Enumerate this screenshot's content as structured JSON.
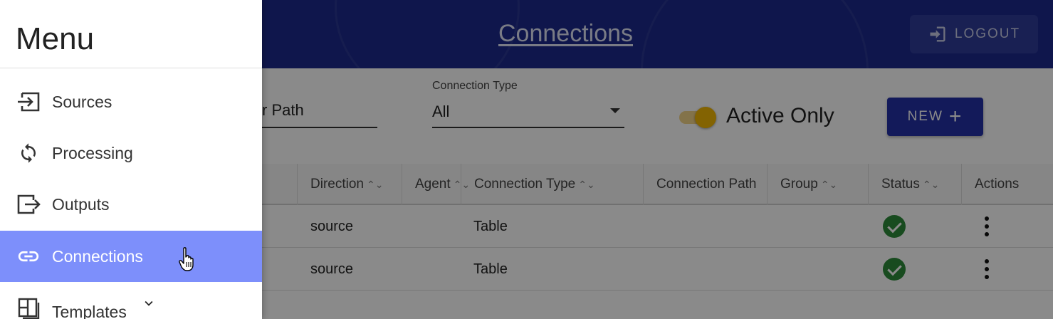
{
  "header": {
    "title": "Connections",
    "logout_label": "LOGOUT",
    "background_color": "#1d2a8c"
  },
  "filters": {
    "path_value_fragment": "r Path",
    "connection_type_label": "Connection Type",
    "connection_type_value": "All",
    "active_only_label": "Active Only",
    "active_only_on": true,
    "new_label": "NEW"
  },
  "table": {
    "columns": [
      {
        "label": "Direction",
        "sortable": true
      },
      {
        "label": "Agent",
        "sortable": true
      },
      {
        "label": "Connection Type",
        "sortable": true
      },
      {
        "label": "Connection Path",
        "sortable": false
      },
      {
        "label": "Group",
        "sortable": true
      },
      {
        "label": "Status",
        "sortable": true
      },
      {
        "label": "Actions",
        "sortable": false
      }
    ],
    "rows": [
      {
        "direction": "source",
        "agent": "",
        "connection_type": "Table",
        "connection_path": "",
        "group": "",
        "status": "active"
      },
      {
        "direction": "source",
        "agent": "",
        "connection_type": "Table",
        "connection_path": "",
        "group": "",
        "status": "active"
      }
    ]
  },
  "menu": {
    "title": "Menu",
    "items": [
      {
        "label": "Sources",
        "icon": "input-icon",
        "active": false
      },
      {
        "label": "Processing",
        "icon": "sync-icon",
        "active": false
      },
      {
        "label": "Outputs",
        "icon": "output-icon",
        "active": false
      },
      {
        "label": "Connections",
        "icon": "link-icon",
        "active": true
      },
      {
        "label": "Templates",
        "icon": "dashboard-icon",
        "active": false,
        "expandable": true
      }
    ],
    "active_color": "#7d8ffb"
  }
}
